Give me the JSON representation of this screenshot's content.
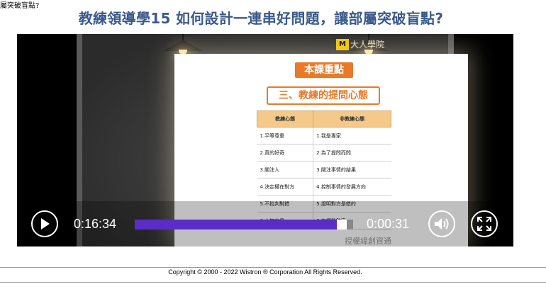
{
  "header": {
    "fragment_text": "屬突破盲點?",
    "title": "教練領導學15 如何設計一連串好問題，讓部屬突破盲點?"
  },
  "video": {
    "logo_mark": "M",
    "logo_text": "大人學院",
    "slide_badge": "本課重點",
    "slide_subtitle": "三、教練的提問心態",
    "table": {
      "headers": [
        "教練心態",
        "非教練心態"
      ],
      "rows": [
        [
          "1.平等尊重",
          "1.我是專家"
        ],
        [
          "2.真的好奇",
          "2.為了提問而問"
        ],
        [
          "3.關注人",
          "3.關注事情的結果"
        ],
        [
          "4.決定權在對方",
          "4.控制事情的發展方向"
        ],
        [
          "5.不批判對錯",
          "5.證明對方是錯的"
        ],
        [
          "6.心無定見",
          "6.有標準答案"
        ]
      ]
    },
    "watermark": "授權緯創資通",
    "elapsed": "0:16:34",
    "remaining": "0:00:31",
    "progress_fraction": 0.97,
    "accent_color": "#5a2dc8"
  },
  "footer": {
    "copyright": "Copyright © 2000 - 2022 Wistron ® Corporation All Rights Reserved."
  }
}
